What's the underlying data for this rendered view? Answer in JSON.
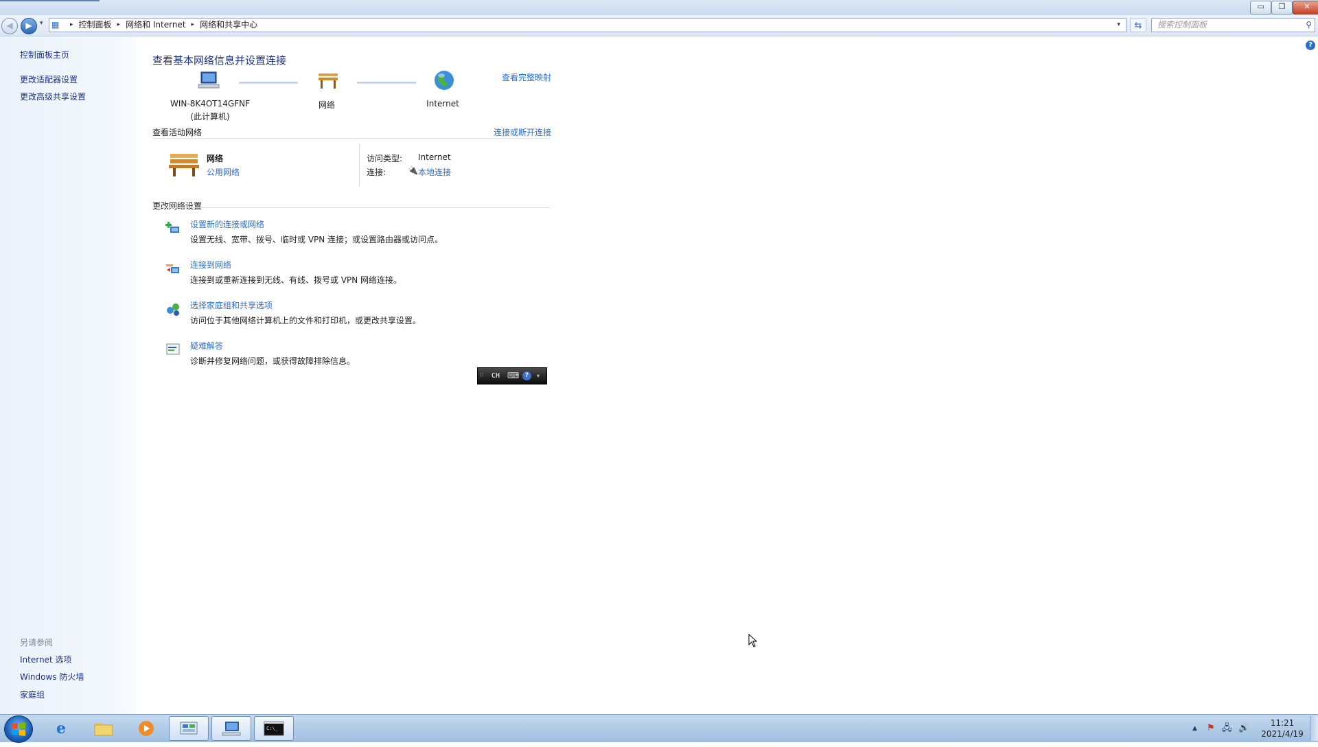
{
  "window": {
    "controls": {
      "minimize_glyph": "▭",
      "restore_glyph": "❐",
      "close_glyph": "✕"
    }
  },
  "address_bar": {
    "back_glyph": "◀",
    "forward_glyph": "▶",
    "history_glyph": "▾",
    "breadcrumbs": [
      "控制面板",
      "网络和 Internet",
      "网络和共享中心"
    ],
    "separator_glyph": "▸",
    "dropdown_glyph": "▾",
    "refresh_glyph": "⇆",
    "search_placeholder": "搜索控制面板",
    "search_icon_glyph": "⚲"
  },
  "sidebar": {
    "home_link": "控制面板主页",
    "links": [
      "更改适配器设置",
      "更改高级共享设置"
    ],
    "see_also_heading": "另请参阅",
    "see_also": [
      "Internet 选项",
      "Windows 防火墙",
      "家庭组"
    ]
  },
  "main": {
    "title": "查看基本网络信息并设置连接",
    "view_full_map": "查看完整映射",
    "map": {
      "computer_name": "WIN-8K4OT14GFNF",
      "computer_subtitle": "(此计算机)",
      "network_label": "网络",
      "internet_label": "Internet"
    },
    "active_networks": {
      "heading": "查看活动网络",
      "connect_disconnect": "连接或断开连接",
      "network_name": "网络",
      "network_type": "公用网络",
      "access_type_label": "访问类型:",
      "access_type_value": "Internet",
      "connections_label": "连接:",
      "connection_name": "本地连接"
    },
    "change_settings": {
      "heading": "更改网络设置",
      "tasks": [
        {
          "link": "设置新的连接或网络",
          "desc": "设置无线、宽带、拨号、临时或 VPN 连接；或设置路由器或访问点。"
        },
        {
          "link": "连接到网络",
          "desc": "连接到或重新连接到无线、有线、拨号或 VPN 网络连接。"
        },
        {
          "link": "选择家庭组和共享选项",
          "desc": "访问位于其他网络计算机上的文件和打印机，或更改共享设置。"
        },
        {
          "link": "疑难解答",
          "desc": "诊断并修复网络问题，或获得故障排除信息。"
        }
      ]
    }
  },
  "ime_bar": {
    "language": "CH"
  },
  "taskbar": {
    "clock_time": "11:21",
    "clock_date": "2021/4/19",
    "tray_arrow": "▲"
  }
}
